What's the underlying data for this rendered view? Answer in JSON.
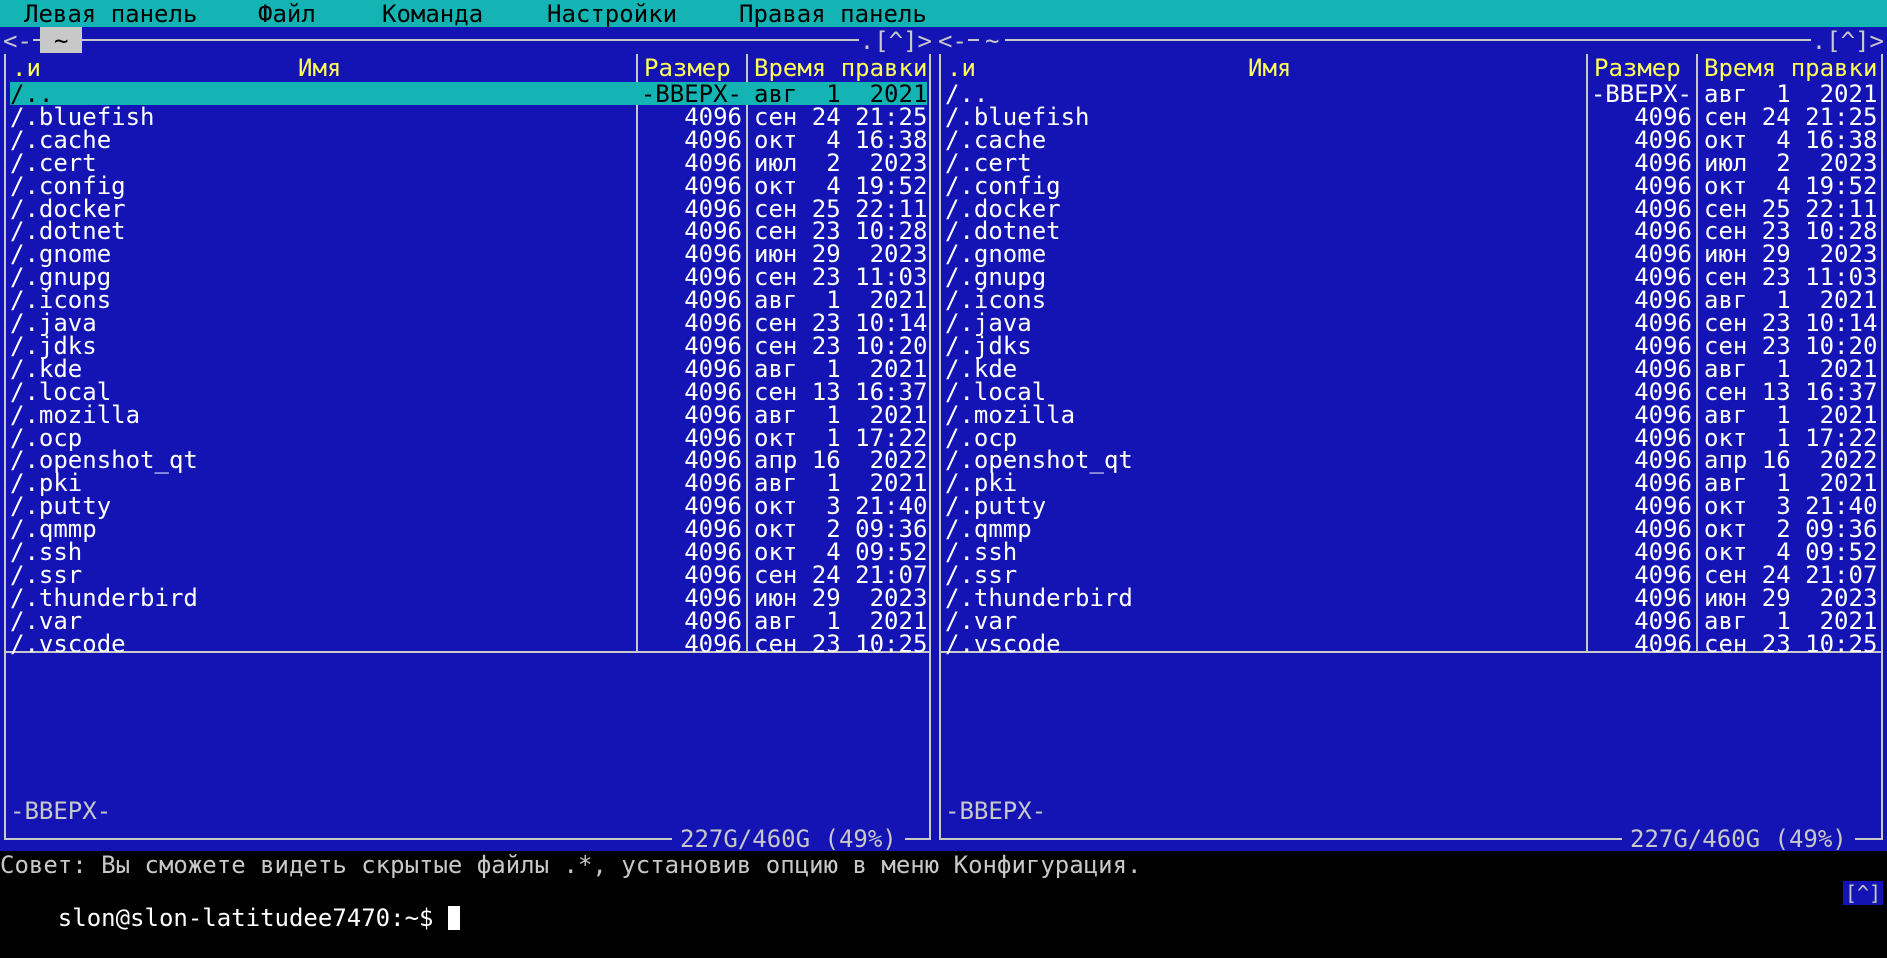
{
  "menubar": {
    "items": [
      "Левая панель",
      "Файл",
      "Команда",
      "Настройки",
      "Правая панель"
    ]
  },
  "left_panel": {
    "left_marker": "<-",
    "path": "~",
    "right_marker": ".[^]>",
    "columns": {
      "mark": ".и",
      "name": "Имя",
      "size": "Размер",
      "time": "Время правки"
    },
    "rows": [
      {
        "name": "/..",
        "size": "-ВВЕРХ-",
        "time": "авг  1  2021",
        "selected": true
      },
      {
        "name": "/.bluefish",
        "size": "4096",
        "time": "сен 24 21:25"
      },
      {
        "name": "/.cache",
        "size": "4096",
        "time": "окт  4 16:38"
      },
      {
        "name": "/.cert",
        "size": "4096",
        "time": "июл  2  2023"
      },
      {
        "name": "/.config",
        "size": "4096",
        "time": "окт  4 19:52"
      },
      {
        "name": "/.docker",
        "size": "4096",
        "time": "сен 25 22:11"
      },
      {
        "name": "/.dotnet",
        "size": "4096",
        "time": "сен 23 10:28"
      },
      {
        "name": "/.gnome",
        "size": "4096",
        "time": "июн 29  2023"
      },
      {
        "name": "/.gnupg",
        "size": "4096",
        "time": "сен 23 11:03"
      },
      {
        "name": "/.icons",
        "size": "4096",
        "time": "авг  1  2021"
      },
      {
        "name": "/.java",
        "size": "4096",
        "time": "сен 23 10:14"
      },
      {
        "name": "/.jdks",
        "size": "4096",
        "time": "сен 23 10:20"
      },
      {
        "name": "/.kde",
        "size": "4096",
        "time": "авг  1  2021"
      },
      {
        "name": "/.local",
        "size": "4096",
        "time": "сен 13 16:37"
      },
      {
        "name": "/.mozilla",
        "size": "4096",
        "time": "авг  1  2021"
      },
      {
        "name": "/.ocp",
        "size": "4096",
        "time": "окт  1 17:22"
      },
      {
        "name": "/.openshot_qt",
        "size": "4096",
        "time": "апр 16  2022"
      },
      {
        "name": "/.pki",
        "size": "4096",
        "time": "авг  1  2021"
      },
      {
        "name": "/.putty",
        "size": "4096",
        "time": "окт  3 21:40"
      },
      {
        "name": "/.qmmp",
        "size": "4096",
        "time": "окт  2 09:36"
      },
      {
        "name": "/.ssh",
        "size": "4096",
        "time": "окт  4 09:52"
      },
      {
        "name": "/.ssr",
        "size": "4096",
        "time": "сен 24 21:07"
      },
      {
        "name": "/.thunderbird",
        "size": "4096",
        "time": "июн 29  2023"
      },
      {
        "name": "/.var",
        "size": "4096",
        "time": "авг  1  2021"
      },
      {
        "name": "/.vscode",
        "size": "4096",
        "time": "сен 23 10:25"
      }
    ],
    "mini_status": "-ВВЕРХ-",
    "disk_info": "227G/460G (49%)"
  },
  "right_panel": {
    "left_marker": "<-",
    "path": "~",
    "right_marker": ".[^]>",
    "columns": {
      "mark": ".и",
      "name": "Имя",
      "size": "Размер",
      "time": "Время правки"
    },
    "rows": [
      {
        "name": "/..",
        "size": "-ВВЕРХ-",
        "time": "авг  1  2021"
      },
      {
        "name": "/.bluefish",
        "size": "4096",
        "time": "сен 24 21:25"
      },
      {
        "name": "/.cache",
        "size": "4096",
        "time": "окт  4 16:38"
      },
      {
        "name": "/.cert",
        "size": "4096",
        "time": "июл  2  2023"
      },
      {
        "name": "/.config",
        "size": "4096",
        "time": "окт  4 19:52"
      },
      {
        "name": "/.docker",
        "size": "4096",
        "time": "сен 25 22:11"
      },
      {
        "name": "/.dotnet",
        "size": "4096",
        "time": "сен 23 10:28"
      },
      {
        "name": "/.gnome",
        "size": "4096",
        "time": "июн 29  2023"
      },
      {
        "name": "/.gnupg",
        "size": "4096",
        "time": "сен 23 11:03"
      },
      {
        "name": "/.icons",
        "size": "4096",
        "time": "авг  1  2021"
      },
      {
        "name": "/.java",
        "size": "4096",
        "time": "сен 23 10:14"
      },
      {
        "name": "/.jdks",
        "size": "4096",
        "time": "сен 23 10:20"
      },
      {
        "name": "/.kde",
        "size": "4096",
        "time": "авг  1  2021"
      },
      {
        "name": "/.local",
        "size": "4096",
        "time": "сен 13 16:37"
      },
      {
        "name": "/.mozilla",
        "size": "4096",
        "time": "авг  1  2021"
      },
      {
        "name": "/.ocp",
        "size": "4096",
        "time": "окт  1 17:22"
      },
      {
        "name": "/.openshot_qt",
        "size": "4096",
        "time": "апр 16  2022"
      },
      {
        "name": "/.pki",
        "size": "4096",
        "time": "авг  1  2021"
      },
      {
        "name": "/.putty",
        "size": "4096",
        "time": "окт  3 21:40"
      },
      {
        "name": "/.qmmp",
        "size": "4096",
        "time": "окт  2 09:36"
      },
      {
        "name": "/.ssh",
        "size": "4096",
        "time": "окт  4 09:52"
      },
      {
        "name": "/.ssr",
        "size": "4096",
        "time": "сен 24 21:07"
      },
      {
        "name": "/.thunderbird",
        "size": "4096",
        "time": "июн 29  2023"
      },
      {
        "name": "/.var",
        "size": "4096",
        "time": "авг  1  2021"
      },
      {
        "name": "/.vscode",
        "size": "4096",
        "time": "сен 23 10:25"
      }
    ],
    "mini_status": "-ВВЕРХ-",
    "disk_info": "227G/460G (49%)"
  },
  "hint": "Совет: Вы сможете видеть скрытые файлы .*, установив опцию в меню Конфигурация.",
  "prompt": "slon@slon-latitudee7470:~$ ",
  "corner_button": "[^]",
  "colors": {
    "menubar_bg": "#14b4b4",
    "panel_bg": "#1414b4",
    "header_text": "#ffff55",
    "frame": "#c8c8c8",
    "selection_bg": "#14b4b4"
  }
}
